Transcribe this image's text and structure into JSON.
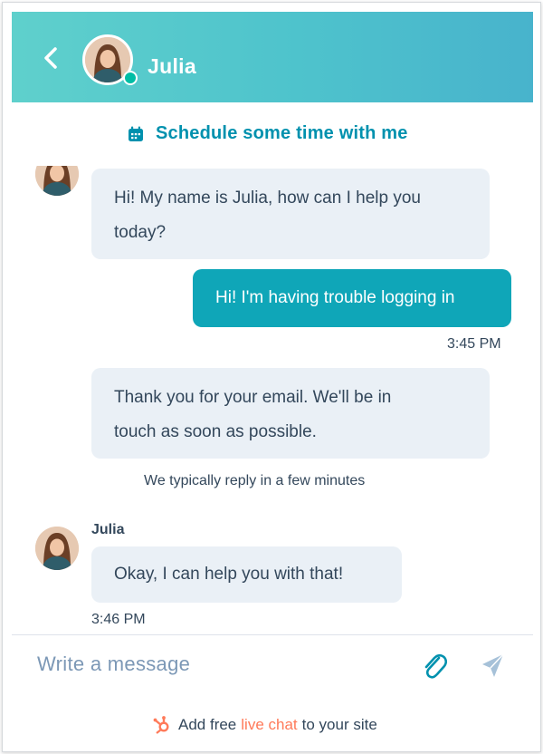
{
  "header": {
    "name": "Julia"
  },
  "schedule": {
    "label": "Schedule some time with me"
  },
  "messages": [
    {
      "line1": "Hi! My name is Julia, how can I help you",
      "line2": "today?"
    },
    {
      "text": "Hi! I'm having trouble logging in",
      "time": "3:45 PM"
    },
    {
      "line1": "Thank you for your email. We'll be in",
      "line2": "touch as soon as possible."
    },
    {
      "sender": "Julia",
      "text": "Okay, I can help you with that!",
      "time": "3:46 PM"
    }
  ],
  "notice": "We typically reply in a few minutes",
  "composer": {
    "placeholder": "Write a message"
  },
  "branding": {
    "prefix": "Add free",
    "highlight": "live chat",
    "suffix": "to your site"
  },
  "colors": {
    "accent": "#0fa6b8",
    "brand_orange": "#ff7a59",
    "online": "#00bda5"
  }
}
